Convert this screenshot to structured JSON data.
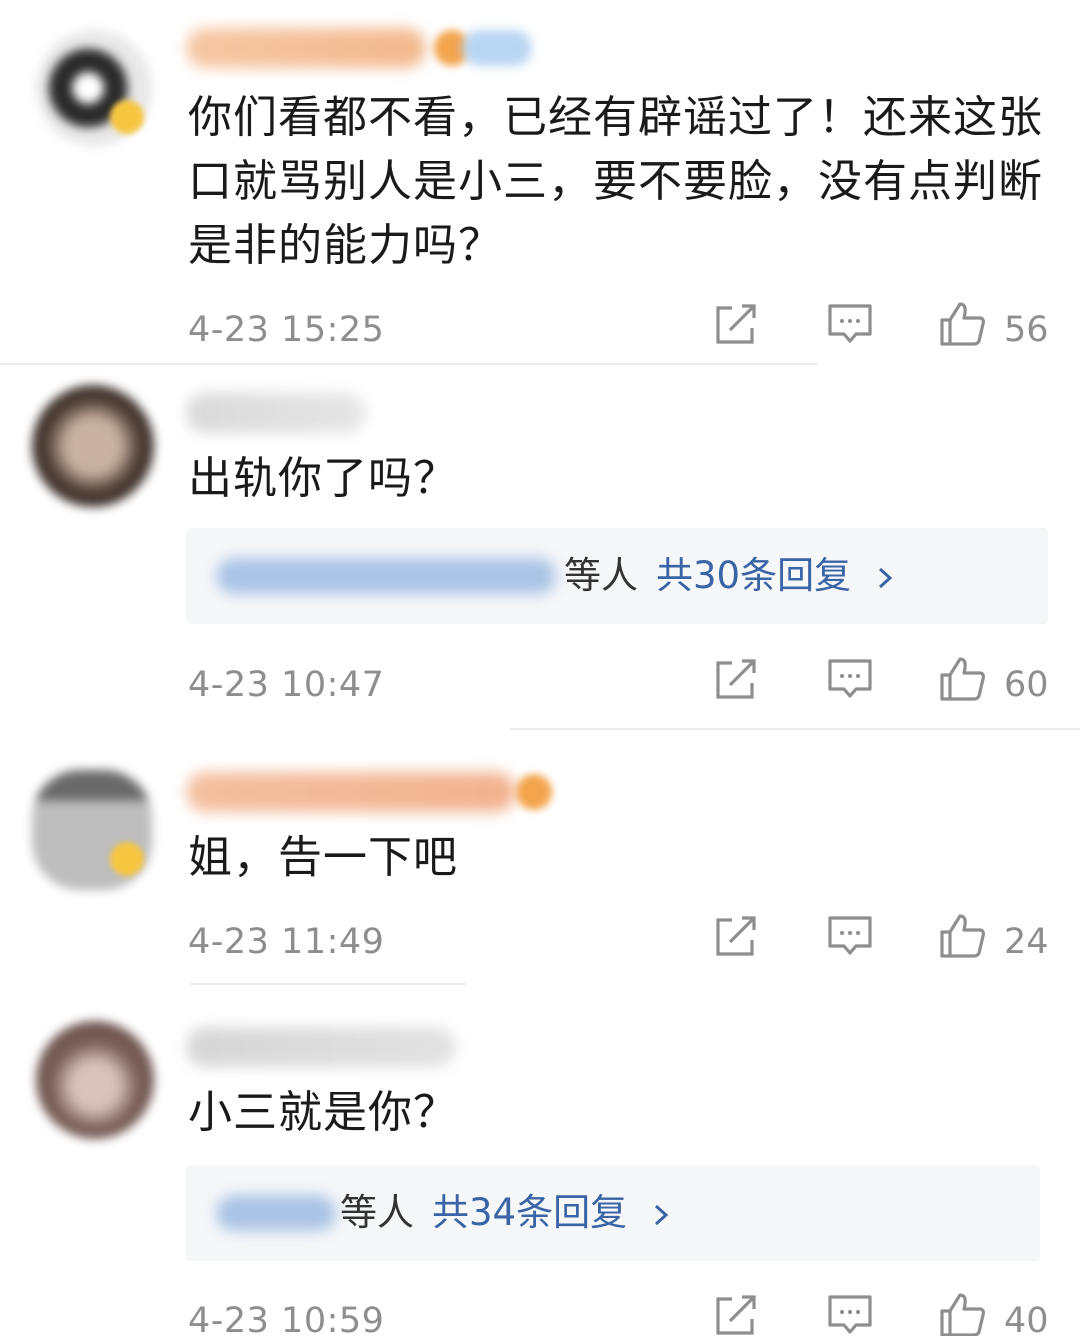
{
  "colors": {
    "text_primary": "#1a1a1a",
    "text_meta": "#8e8e8e",
    "link_blue": "#3a64a6",
    "reply_box_bg": "#f6f7f9"
  },
  "icons": {
    "share": "share-icon",
    "comment": "comment-icon",
    "like": "thumbs-up-icon",
    "reply_chevron": "chevron-right-icon"
  },
  "comments": [
    {
      "text": "你们看都不看，已经有辟谣过了！还来这张口就骂别人是小三，要不要脸，没有点判断是非的能力吗？",
      "time": "4-23 15:25",
      "likes": "56"
    },
    {
      "text": "出轨你了吗？",
      "reply_suffix": "等人",
      "reply_total": "共30条回复",
      "time": "4-23 10:47",
      "likes": "60"
    },
    {
      "text": "姐，告一下吧",
      "time": "4-23 11:49",
      "likes": "24"
    },
    {
      "text": "小三就是你？",
      "reply_suffix": "等人",
      "reply_total": "共34条回复",
      "time": "4-23 10:59",
      "likes": "40"
    }
  ]
}
